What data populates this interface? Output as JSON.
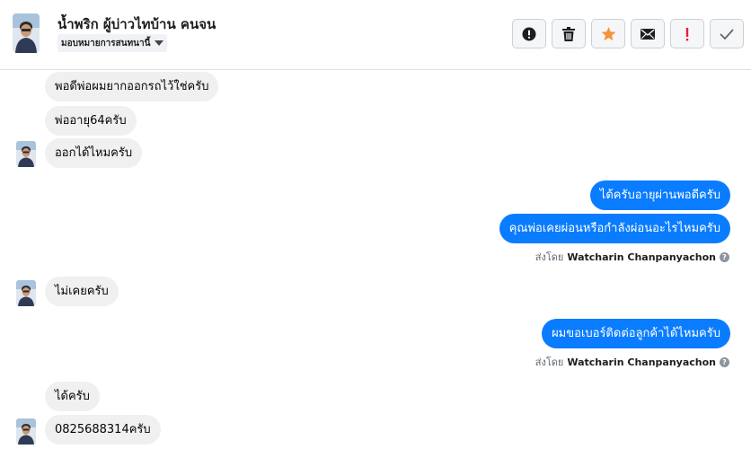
{
  "header": {
    "name": "น้ำพริก ผู้บ่าวไทบ้าน คนจน",
    "assign_label": "มอบหมายการสนทนานี้",
    "toolbar": [
      "alert-circle-icon",
      "trash-icon",
      "star-icon",
      "mail-icon",
      "exclamation-icon",
      "check-icon"
    ]
  },
  "messages": [
    {
      "dir": "in",
      "text": "พอดีพ่อผมยากออกรถไว้ใช่ครับ"
    },
    {
      "dir": "in",
      "text": "พ่ออายุ64ครับ"
    },
    {
      "dir": "in",
      "text": "ออกได้ไหมครับ"
    },
    {
      "dir": "out",
      "text": "ได้ครับอายุผ่านพอดีครับ"
    },
    {
      "dir": "out",
      "text": "คุณพ่อเคยผ่อนหรือกำลังผ่อนอะไรไหมครับ"
    },
    {
      "dir": "in",
      "text": "ไม่เคยครับ"
    },
    {
      "dir": "out",
      "text": "ผมขอเบอร์ติดต่อลูกค้าได้ไหมครับ"
    },
    {
      "dir": "in",
      "text": "ได้ครับ"
    },
    {
      "dir": "in",
      "text": "0825688314ครับ"
    }
  ],
  "sent_by": {
    "prefix": "ส่งโดย",
    "name": "Watcharin Chanpanyachon"
  },
  "colors": {
    "outgoing_bubble": "#0a7cff",
    "incoming_bubble": "#f0f0f0",
    "star": "#f7923b",
    "red_alert": "#e41e3f"
  }
}
